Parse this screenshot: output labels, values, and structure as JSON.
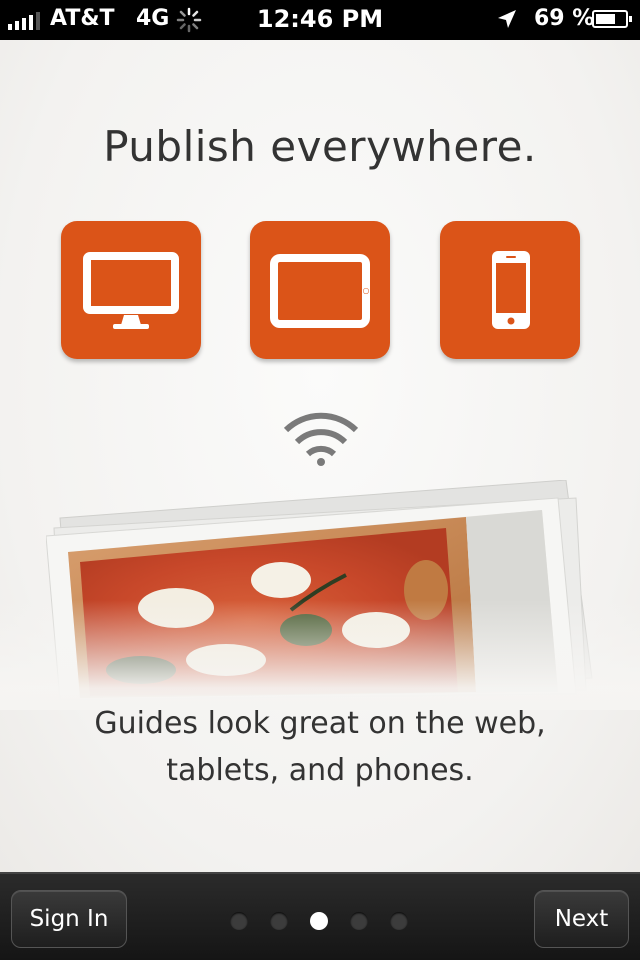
{
  "status_bar": {
    "carrier": "AT&T",
    "network": "4G",
    "time": "12:46 PM",
    "battery": "69 %",
    "battery_level": 0.69
  },
  "onboarding": {
    "headline": "Publish everywhere.",
    "devices": [
      "desktop-icon",
      "tablet-icon",
      "phone-icon"
    ],
    "caption_line1": "Guides look great on the web,",
    "caption_line2": "tablets, and phones."
  },
  "toolbar": {
    "sign_in_label": "Sign In",
    "next_label": "Next",
    "page_count": 5,
    "current_page": 3
  },
  "colors": {
    "accent": "#db5418",
    "toolbar": "#1c1c1c"
  }
}
